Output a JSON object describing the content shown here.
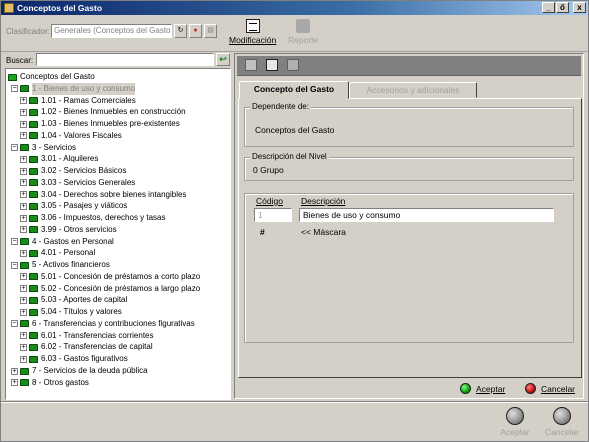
{
  "window": {
    "title": "Conceptos del Gasto",
    "buttons": {
      "minimize": "_",
      "restore": "ő",
      "close": "x"
    }
  },
  "toolbar": {
    "clasificador_label": "Clasificador:",
    "clasificador_value": "Generales (Conceptos del Gasto)",
    "modificacion_label": "Modificación",
    "reporte_label": "Reporte"
  },
  "search": {
    "label": "Buscar:",
    "value": ""
  },
  "tree": {
    "nodes": [
      {
        "label": "Conceptos del Gasto",
        "level": 0,
        "expander": "",
        "selected": false
      },
      {
        "label": "1 - Bienes de uso y consumo",
        "level": 1,
        "expander": "−",
        "selected": true
      },
      {
        "label": "1.01 - Ramas Comerciales",
        "level": 2,
        "expander": "+",
        "selected": false
      },
      {
        "label": "1.02 - Bienes Inmuebles en construcción",
        "level": 2,
        "expander": "+",
        "selected": false
      },
      {
        "label": "1.03 - Bienes Inmuebles pre-existentes",
        "level": 2,
        "expander": "+",
        "selected": false
      },
      {
        "label": "1.04 - Valores Fiscales",
        "level": 2,
        "expander": "+",
        "selected": false
      },
      {
        "label": "3 - Servicios",
        "level": 1,
        "expander": "−",
        "selected": false
      },
      {
        "label": "3.01 - Alquileres",
        "level": 2,
        "expander": "+",
        "selected": false
      },
      {
        "label": "3.02 - Servicios Básicos",
        "level": 2,
        "expander": "+",
        "selected": false
      },
      {
        "label": "3.03 - Servicios Generales",
        "level": 2,
        "expander": "+",
        "selected": false
      },
      {
        "label": "3.04 - Derechos sobre bienes intangibles",
        "level": 2,
        "expander": "+",
        "selected": false
      },
      {
        "label": "3.05 - Pasajes y viáticos",
        "level": 2,
        "expander": "+",
        "selected": false
      },
      {
        "label": "3.06 - Impuestos, derechos y tasas",
        "level": 2,
        "expander": "+",
        "selected": false
      },
      {
        "label": "3.99 - Otros servicios",
        "level": 2,
        "expander": "+",
        "selected": false
      },
      {
        "label": "4 - Gastos en Personal",
        "level": 1,
        "expander": "−",
        "selected": false
      },
      {
        "label": "4.01 - Personal",
        "level": 2,
        "expander": "+",
        "selected": false
      },
      {
        "label": "5 - Activos financieros",
        "level": 1,
        "expander": "−",
        "selected": false
      },
      {
        "label": "5.01 - Concesión de préstamos a corto plazo",
        "level": 2,
        "expander": "+",
        "selected": false
      },
      {
        "label": "5.02 - Concesión de préstamos a largo plazo",
        "level": 2,
        "expander": "+",
        "selected": false
      },
      {
        "label": "5.03 - Aportes de capital",
        "level": 2,
        "expander": "+",
        "selected": false
      },
      {
        "label": "5.04 - Títulos y valores",
        "level": 2,
        "expander": "+",
        "selected": false
      },
      {
        "label": "6 - Transferencias y contribuciones figurativas",
        "level": 1,
        "expander": "−",
        "selected": false
      },
      {
        "label": "6.01 - Transferencias corrientes",
        "level": 2,
        "expander": "+",
        "selected": false
      },
      {
        "label": "6.02 - Transferencias de capital",
        "level": 2,
        "expander": "+",
        "selected": false
      },
      {
        "label": "6.03 - Gastos figurativos",
        "level": 2,
        "expander": "+",
        "selected": false
      },
      {
        "label": "7 - Servicios de la deuda pública",
        "level": 1,
        "expander": "+",
        "selected": false
      },
      {
        "label": "8 - Otros gastos",
        "level": 1,
        "expander": "+",
        "selected": false
      }
    ]
  },
  "detail": {
    "tabs": [
      {
        "label": "Concepto del Gasto",
        "active": true
      },
      {
        "label": "Accesorios y adicionales",
        "active": false
      }
    ],
    "dependiente_title": "Dependente de:",
    "dependiente_value": "Conceptos del Gasto",
    "nivel_title": "Descripción del Nivel",
    "nivel_value": "0 Grupo",
    "codigo_header": "Código",
    "descripcion_header": "Descripción",
    "codigo_value": "1",
    "descripcion_value": "Bienes de uso y consumo",
    "mask_hash": "#",
    "mask_label": "<< Máscara",
    "aceptar_label": "Aceptar",
    "cancelar_label": "Cancelar"
  },
  "footer": {
    "aceptar_label": "Aceptar",
    "cancelar_label": "Cancelar"
  }
}
